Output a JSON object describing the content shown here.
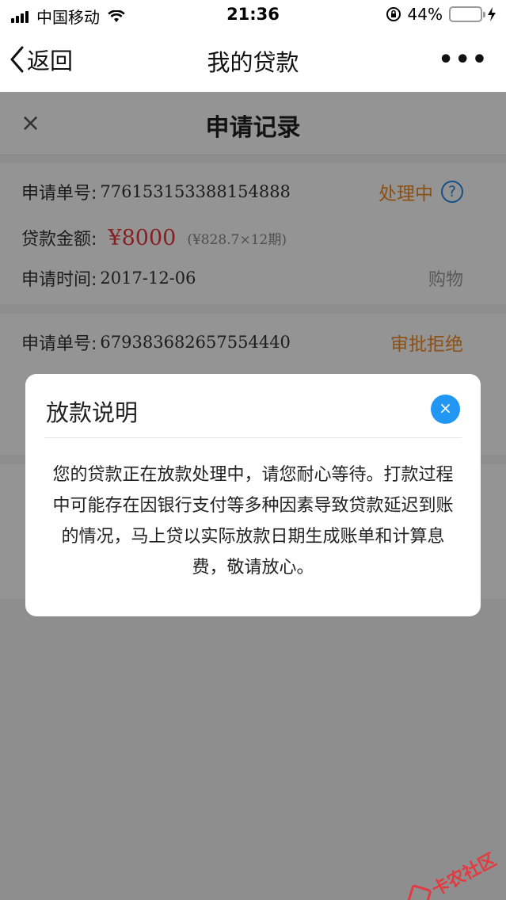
{
  "status_bar": {
    "carrier": "中国移动",
    "time": "21:36",
    "battery_percent": "44%",
    "battery_level": 0.44,
    "icons": [
      "signal-icon",
      "wifi-icon",
      "orientation-lock-icon",
      "battery-icon",
      "charging-icon"
    ]
  },
  "nav": {
    "back_label": "返回",
    "title": "我的贷款",
    "more_label": "•••"
  },
  "page": {
    "close_label": "×",
    "title": "申请记录"
  },
  "records": [
    {
      "order_label": "申请单号:",
      "order_no": "776153153388154888",
      "status": "处理中",
      "amount_label": "贷款金额:",
      "amount": "¥8000",
      "amount_detail": "(¥828.7×12期)",
      "time_label": "申请时间:",
      "time": "2017-12-06",
      "category": "购物"
    },
    {
      "order_label": "申请单号:",
      "order_no": "679383682657554440",
      "status": "审批拒绝"
    }
  ],
  "modal": {
    "title": "放款说明",
    "close_label": "×",
    "body": "您的贷款正在放款处理中，请您耐心等待。打款过程中可能存在因银行支付等多种因素导致贷款延迟到账的情况，马上贷以实际放款日期生成账单和计算息费，敬请放心。"
  },
  "watermark": {
    "text": "卡农社区"
  },
  "colors": {
    "status_orange": "#f08a24",
    "amount_red": "#e8363c",
    "accent_blue": "#2196f3"
  }
}
